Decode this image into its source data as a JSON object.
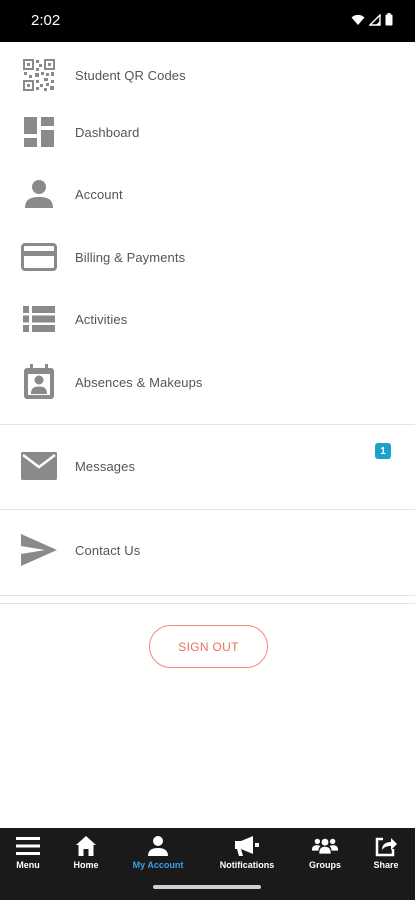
{
  "status_bar": {
    "time": "2:02"
  },
  "menu": {
    "items": [
      {
        "id": "student-qr-codes",
        "label": "Student QR Codes",
        "icon": "qr-code-icon"
      },
      {
        "id": "dashboard",
        "label": "Dashboard",
        "icon": "dashboard-icon"
      },
      {
        "id": "account",
        "label": "Account",
        "icon": "person-icon"
      },
      {
        "id": "billing",
        "label": "Billing & Payments",
        "icon": "credit-card-icon"
      },
      {
        "id": "activities",
        "label": "Activities",
        "icon": "list-icon"
      },
      {
        "id": "absences",
        "label": "Absences & Makeups",
        "icon": "calendar-badge-icon"
      },
      {
        "id": "messages",
        "label": "Messages",
        "icon": "envelope-icon",
        "badge": "1"
      },
      {
        "id": "contact",
        "label": "Contact Us",
        "icon": "send-icon"
      }
    ]
  },
  "sign_out": {
    "label": "SIGN OUT"
  },
  "bottom_nav": {
    "items": [
      {
        "label": "Menu",
        "icon": "hamburger-icon"
      },
      {
        "label": "Home",
        "icon": "home-icon"
      },
      {
        "label": "My Account",
        "icon": "person-icon",
        "active": true
      },
      {
        "label": "Notifications",
        "icon": "megaphone-icon"
      },
      {
        "label": "Groups",
        "icon": "groups-icon"
      },
      {
        "label": "Share",
        "icon": "share-icon"
      }
    ]
  },
  "colors": {
    "icon_gray": "#8a8a8a",
    "badge": "#1aa3c9",
    "sign_out": "#ee6e60",
    "nav_active": "#3aa0e8",
    "nav_bg": "#1a1a1a"
  }
}
